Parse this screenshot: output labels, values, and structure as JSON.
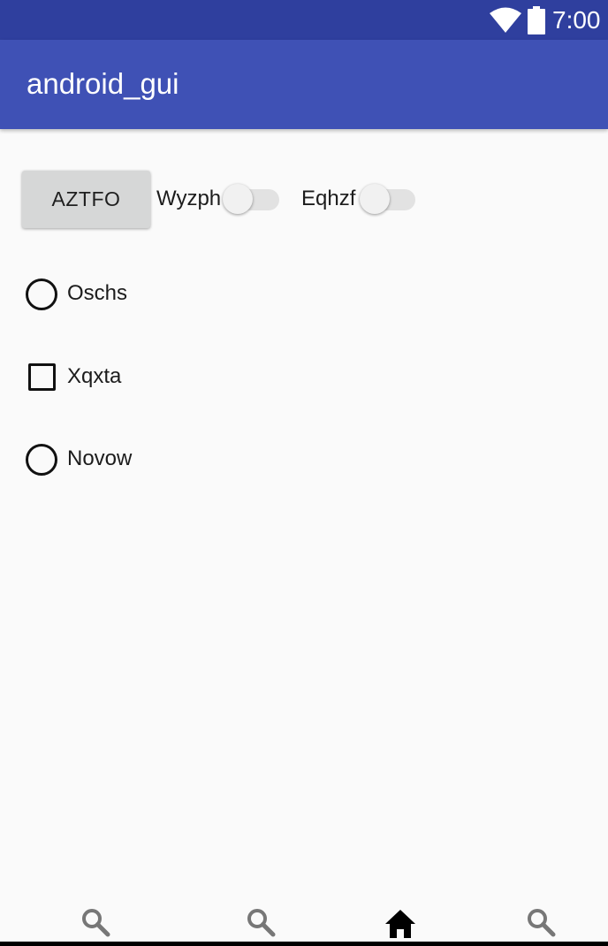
{
  "status_bar": {
    "time": "7:00",
    "wifi_icon": "wifi-icon",
    "battery_icon": "battery-icon",
    "background": "#2f3f9e"
  },
  "app_bar": {
    "title": "android_gui",
    "background": "#3f51b5"
  },
  "content": {
    "button_label": "AZTFO",
    "switches": [
      {
        "label": "Wyzph",
        "checked": false
      },
      {
        "label": "Eqhzf",
        "checked": false
      }
    ],
    "options": [
      {
        "type": "radio",
        "label": "Oschs",
        "checked": false
      },
      {
        "type": "checkbox",
        "label": "Xqxta",
        "checked": false
      },
      {
        "type": "radio",
        "label": "Novow",
        "checked": false
      }
    ]
  },
  "bottom_nav": {
    "items": [
      {
        "icon": "search-icon"
      },
      {
        "icon": "search-icon"
      },
      {
        "icon": "home-icon"
      },
      {
        "icon": "search-icon"
      }
    ]
  }
}
